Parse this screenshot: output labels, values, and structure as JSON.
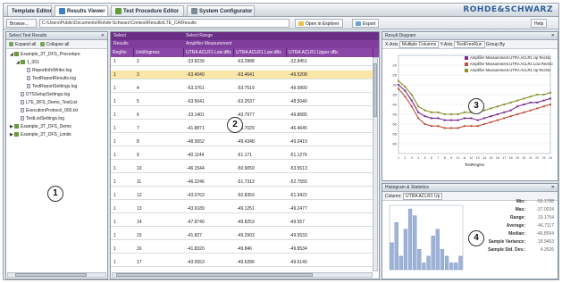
{
  "tabs": [
    {
      "label": "Template Editor",
      "active": false
    },
    {
      "label": "Results Viewer",
      "active": true
    },
    {
      "label": "Test Procedure Editor",
      "active": false
    },
    {
      "label": "System Configurator",
      "active": false
    }
  ],
  "brand": "ROHDE&SCHWARZ",
  "pathbar": {
    "browse_label": "Browse...",
    "path": "C:\\Users\\Public\\Documents\\Rohde-Schwarz\\Contest\\Results\\LTE_CA\\Results",
    "open_button": "Open in Explorer",
    "export_button": "Export",
    "help_button": "Help"
  },
  "left_panel": {
    "title": "Select Test Results",
    "expand_all": "Expand all",
    "collapse_all": "Collapse all",
    "tree": [
      {
        "label": "Example_3T_DFS_Procedure",
        "level": 0,
        "type": "folder",
        "expanded": true
      },
      {
        "label": "1_001",
        "level": 1,
        "type": "folder",
        "expanded": true
      },
      {
        "label": "ReportInfoWriter.log",
        "level": 2,
        "type": "file"
      },
      {
        "label": "TestReportResults.log",
        "level": 2,
        "type": "file"
      },
      {
        "label": "TestReportSettings.log",
        "level": 2,
        "type": "file"
      },
      {
        "label": "DTSSetupSettings.log",
        "level": 1,
        "type": "file"
      },
      {
        "label": "LTE_DFS_Demo_TestList",
        "level": 1,
        "type": "file"
      },
      {
        "label": "ExecutionProtocol_000.txt",
        "level": 1,
        "type": "file"
      },
      {
        "label": "TestListSettings.log",
        "level": 1,
        "type": "file"
      },
      {
        "label": "Example_3T_DFS_Demo",
        "level": 0,
        "type": "folder",
        "expanded": false
      },
      {
        "label": "Example_3T_DFS_Limits",
        "level": 0,
        "type": "folder",
        "expanded": false
      }
    ]
  },
  "grid": {
    "group_header": "Select",
    "group_header_right": "Select Range",
    "subheader_left": "Results",
    "subheader_right": "Amplifier Measurement",
    "columns": [
      "RegNo",
      "Unit/Ingress",
      "UTRA ACLR1 Low dBc",
      "UTRA ACLR1 Low dBc",
      "UTRA ACLR1 Upper dBc"
    ],
    "rows": [
      [
        "1",
        "2",
        "-33.8239",
        "-63.2888",
        "-32.8451"
      ],
      [
        "1",
        "3",
        "-63.4040",
        "-63.4641",
        "-49.5208"
      ],
      [
        "1",
        "4",
        "-63.3761",
        "-53.7519",
        "-49.9999"
      ],
      [
        "1",
        "5",
        "-63.5041",
        "-63.2537",
        "-48.5040"
      ],
      [
        "1",
        "6",
        "-33.1401",
        "-43.7977",
        "-49.8685"
      ],
      [
        "1",
        "7",
        "-41.8871",
        "-43.7029",
        "-46.4645"
      ],
      [
        "1",
        "8",
        "-48.5652",
        "-49.4348",
        "-49.0419"
      ],
      [
        "1",
        "9",
        "-40.1144",
        "-61.171",
        "-51.1276"
      ],
      [
        "1",
        "10",
        "-46.1544",
        "-50.9059",
        "-53.5513"
      ],
      [
        "1",
        "11",
        "-46.2246",
        "-51.7313",
        "-52.7555"
      ],
      [
        "1",
        "12",
        "-43.0763",
        "-50.8359",
        "-51.9422"
      ],
      [
        "1",
        "13",
        "-43.6189",
        "-49.1251",
        "-49.2477"
      ],
      [
        "1",
        "14",
        "-47.8740",
        "-49.8253",
        "-49.557"
      ],
      [
        "1",
        "15",
        "-41.827",
        "-49.2903",
        "-49.5533"
      ],
      [
        "1",
        "16",
        "-41.8320",
        "-49.846",
        "-49.8534"
      ],
      [
        "1",
        "17",
        "-43.0553",
        "-49.6286",
        "-49.6140"
      ]
    ],
    "selected_row": 1
  },
  "chart_panel": {
    "title": "Result Diagram",
    "toolbar": [
      "X-Axis",
      "Multiple Columns",
      "Y-Axis",
      "TestFreeRun",
      "Group By"
    ],
    "x_axis_label": "TestRegNo",
    "legend": [
      {
        "name": "Amplifier Measurement.UTRA ACLR1 Up RecNo",
        "color": "#7b2b8e"
      },
      {
        "name": "Amplifier Measurement.UTRA ACLR1 Low RecNo",
        "color": "#c1503a"
      },
      {
        "name": "Amplifier Measurement.UTRA ACLR1 Up RecNo",
        "color": "#8a8f2e"
      }
    ]
  },
  "chart_data": [
    {
      "type": "line",
      "x": [
        "1",
        "2",
        "3",
        "4",
        "5",
        "6",
        "7",
        "8",
        "9",
        "10",
        "11",
        "12",
        "13",
        "14",
        "15",
        "16",
        "17",
        "18",
        "19",
        "20",
        "21",
        "22",
        "23",
        "24"
      ],
      "ylim": [
        -65,
        -15
      ],
      "yticks": [
        "-20",
        "-25",
        "-30",
        "-35",
        "-40",
        "-45",
        "-50",
        "-55",
        "-60"
      ],
      "xlabel": "TestRegNo",
      "series": [
        {
          "name": "Amplifier Measurement.UTRA ACLR1 Up RecNo",
          "values": [
            -30,
            -33,
            -38,
            -44,
            -46,
            -47,
            -47,
            -48,
            -48,
            -48,
            -47,
            -47,
            -48,
            -47,
            -46,
            -45,
            -44,
            -43,
            -41,
            -40,
            -39,
            -39,
            -38,
            -37
          ]
        },
        {
          "name": "Amplifier Measurement.UTRA ACLR1 Low RecNo",
          "values": [
            -32,
            -36,
            -41,
            -47,
            -50,
            -51,
            -51,
            -52,
            -52,
            -52,
            -51,
            -51,
            -51,
            -50,
            -49,
            -48,
            -47,
            -46,
            -45,
            -44,
            -43,
            -42,
            -41,
            -40
          ]
        },
        {
          "name": "Amplifier Measurement.UTRA ACLR1 Up RecNo",
          "values": [
            -28,
            -31,
            -35,
            -41,
            -43,
            -44,
            -44,
            -45,
            -45,
            -45,
            -44,
            -44,
            -44,
            -43,
            -42,
            -41,
            -40,
            -39,
            -38,
            -37,
            -36,
            -35,
            -35,
            -34
          ]
        }
      ]
    },
    {
      "type": "bar",
      "values": [
        4,
        7,
        2,
        6,
        9,
        8,
        3,
        1,
        2,
        5,
        6,
        3,
        2,
        1,
        1,
        2
      ]
    }
  ],
  "histogram_panel": {
    "title": "Histogram & Statistics",
    "column_label": "Column:",
    "column_value": "UTRA ACLR1 Up",
    "stats": [
      {
        "label": "Min:",
        "value": "-56.1788"
      },
      {
        "label": "Max:",
        "value": "-37.0034"
      },
      {
        "label": "Range:",
        "value": "19.1754"
      },
      {
        "label": "Average:",
        "value": "-46.7117"
      },
      {
        "label": "Median:",
        "value": "-46.8594"
      },
      {
        "label": "Sample Variance:",
        "value": "18.9453"
      },
      {
        "label": "Sample Std. Dev.:",
        "value": "4.3526"
      }
    ]
  },
  "badges": [
    "1",
    "2",
    "3",
    "4"
  ]
}
